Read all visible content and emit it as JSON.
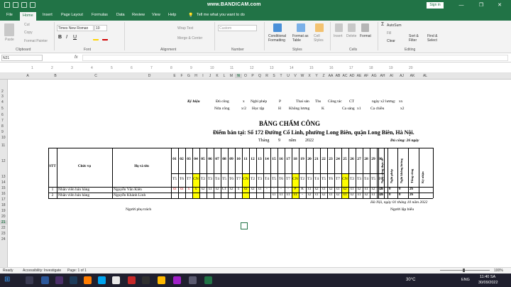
{
  "titlebar": {
    "watermark": "www.BANDICAM.com",
    "sign_in": "Sign in",
    "win_min": "—",
    "win_max": "❐",
    "win_close": "✕"
  },
  "tabs": {
    "items": [
      "File",
      "Home",
      "Insert",
      "Page Layout",
      "Formulas",
      "Data",
      "Review",
      "View",
      "Help"
    ],
    "active": "Home",
    "tell_me": "Tell me what you want to do"
  },
  "ribbon": {
    "cut": "Cut",
    "copy": "Copy",
    "format_painter": "Format Painter",
    "paste": "Paste",
    "font_name": "Times New Roman",
    "font_size": "10",
    "wrap_text": "Wrap Text",
    "merge_center": "Merge & Center",
    "number_format": "Custom",
    "conditional": "Conditional Formatting",
    "format_as_table": "Format as Table",
    "cell_styles": "Cell Styles",
    "insert": "Insert",
    "delete": "Delete",
    "format": "Format",
    "autosum": "AutoSum",
    "fill": "Fill",
    "clear": "Clear",
    "sort_filter": "Sort & Filter",
    "find_select": "Find & Select",
    "groups": [
      "Clipboard",
      "Font",
      "Alignment",
      "Number",
      "Styles",
      "Cells",
      "Editing"
    ]
  },
  "formula_bar": {
    "name_box": "N21",
    "fx": "fx",
    "value": ""
  },
  "columns": [
    "A",
    "B",
    "C",
    "D",
    "E",
    "F",
    "G",
    "H",
    "I",
    "J",
    "K",
    "L",
    "M",
    "N",
    "O",
    "P",
    "Q",
    "R",
    "S",
    "T",
    "U",
    "V",
    "W",
    "X",
    "Y",
    "Z",
    "AA",
    "AB",
    "AC",
    "AD",
    "AE",
    "AF",
    "AG",
    "AH",
    "AI",
    "AJ",
    "AK",
    "AL"
  ],
  "ruler": [
    "1",
    "2",
    "3",
    "4",
    "5",
    "6",
    "7",
    "8",
    "9",
    "10",
    "11",
    "12",
    "13",
    "14",
    "15",
    "16",
    "17",
    "18",
    "19",
    "20"
  ],
  "rows": [
    "2",
    "3",
    "4",
    "5",
    "6",
    "7",
    "8",
    "9",
    "10",
    "11",
    "12",
    "13",
    "14",
    "15",
    "16",
    "17",
    "18",
    "19",
    "20",
    "21",
    "22",
    "23",
    "24"
  ],
  "legend": {
    "header": "Ký hiệu",
    "r1": [
      "Đủ công",
      "x",
      "Nghỉ phép",
      "P",
      "Thai sản",
      "Ths",
      "Công tác",
      "CT",
      "ngày x2 lương:",
      "xx"
    ],
    "r2": [
      "Nửa công",
      "x/2",
      "Học tập",
      "H",
      "Không lương",
      "K",
      "Ca sáng",
      "x1",
      "Ca chiều",
      "x2"
    ]
  },
  "sheet": {
    "title": "BẢNG CHẤM CÔNG",
    "address": "Điểm bán tại: Số 172 Đường Cổ Linh, phường Long Biên, quận Long Biên, Hà Nội.",
    "month_label": "Tháng",
    "month": "9",
    "year_label": "năm",
    "year": "2022",
    "standard_days": "Đủ công: 26 ngày",
    "h_stt": "STT",
    "h_role": "Chức vụ",
    "h_name": "Họ và tên",
    "v_headers": [
      "Ngày công thực tế",
      "Nghỉ phép",
      "Nghỉ không lương",
      "Tổng công",
      "Ký nhận"
    ],
    "days": [
      "01",
      "02",
      "03",
      "04",
      "05",
      "06",
      "07",
      "08",
      "09",
      "10",
      "11",
      "12",
      "13",
      "14",
      "15",
      "16",
      "17",
      "18",
      "19",
      "20",
      "21",
      "22",
      "23",
      "24",
      "25",
      "26",
      "27",
      "28",
      "29",
      "30"
    ],
    "weekdays": [
      "T5",
      "T6",
      "T7",
      "CN",
      "T2",
      "T3",
      "T4",
      "T5",
      "T6",
      "T7",
      "CN",
      "T2",
      "T3",
      "T4",
      "T5",
      "T6",
      "T7",
      "CN",
      "T2",
      "T3",
      "T4",
      "T5",
      "T6",
      "T7",
      "CN",
      "T2",
      "T3",
      "T4",
      "T5",
      "T6"
    ],
    "rows": [
      {
        "stt": "1",
        "role": "Nhân viên bán hàng",
        "name": "Nguyễn Văn Kiên",
        "marks": [
          "xx",
          "xx",
          "x",
          "x",
          "x2",
          "x1",
          "x2",
          "CT",
          "x2",
          "x",
          "xx",
          "x2",
          "x1",
          "-",
          "-",
          "-",
          "-",
          "P",
          "K",
          "x1",
          "x2",
          "x1",
          "x2",
          "x1",
          "x2",
          "x1",
          "x2",
          "x1",
          "x2",
          "x1"
        ],
        "actual": "26",
        "leave": "0",
        "unpaid": "0",
        "total": "26"
      },
      {
        "stt": "2",
        "role": "Nhân viên bán hàng",
        "name": "Nguyễn Khánh Linh",
        "marks": [
          "",
          "",
          "",
          "",
          "",
          "",
          "",
          "",
          "",
          "",
          "",
          "",
          "",
          "",
          "x1",
          "x1",
          "x1",
          "x1",
          "-",
          "x2",
          "x1",
          "x2",
          "x1",
          "x2",
          "x1",
          "x2",
          "x1",
          "x2",
          "x1",
          "x2"
        ],
        "actual": "26",
        "leave": "0",
        "unpaid": "0",
        "total": "26"
      }
    ],
    "date_line": "Hà Nội, ngày 01 tháng 10 năm 2022",
    "responsible": "Người phụ trách",
    "preparer": "Người lập biểu"
  },
  "sheet_tab": "Sheet1",
  "status": {
    "ready": "Ready",
    "accessibility": "Accessibility: Investigate",
    "page": "Page: 1 of 1",
    "zoom": "100%"
  },
  "taskbar": {
    "weather": "30°C",
    "lang": "ENG",
    "time": "11:40 SA",
    "date": "30/09/2022"
  },
  "colors": {
    "excel_green": "#217346",
    "highlight": "#ffff00",
    "red_mark": "#d00000"
  }
}
